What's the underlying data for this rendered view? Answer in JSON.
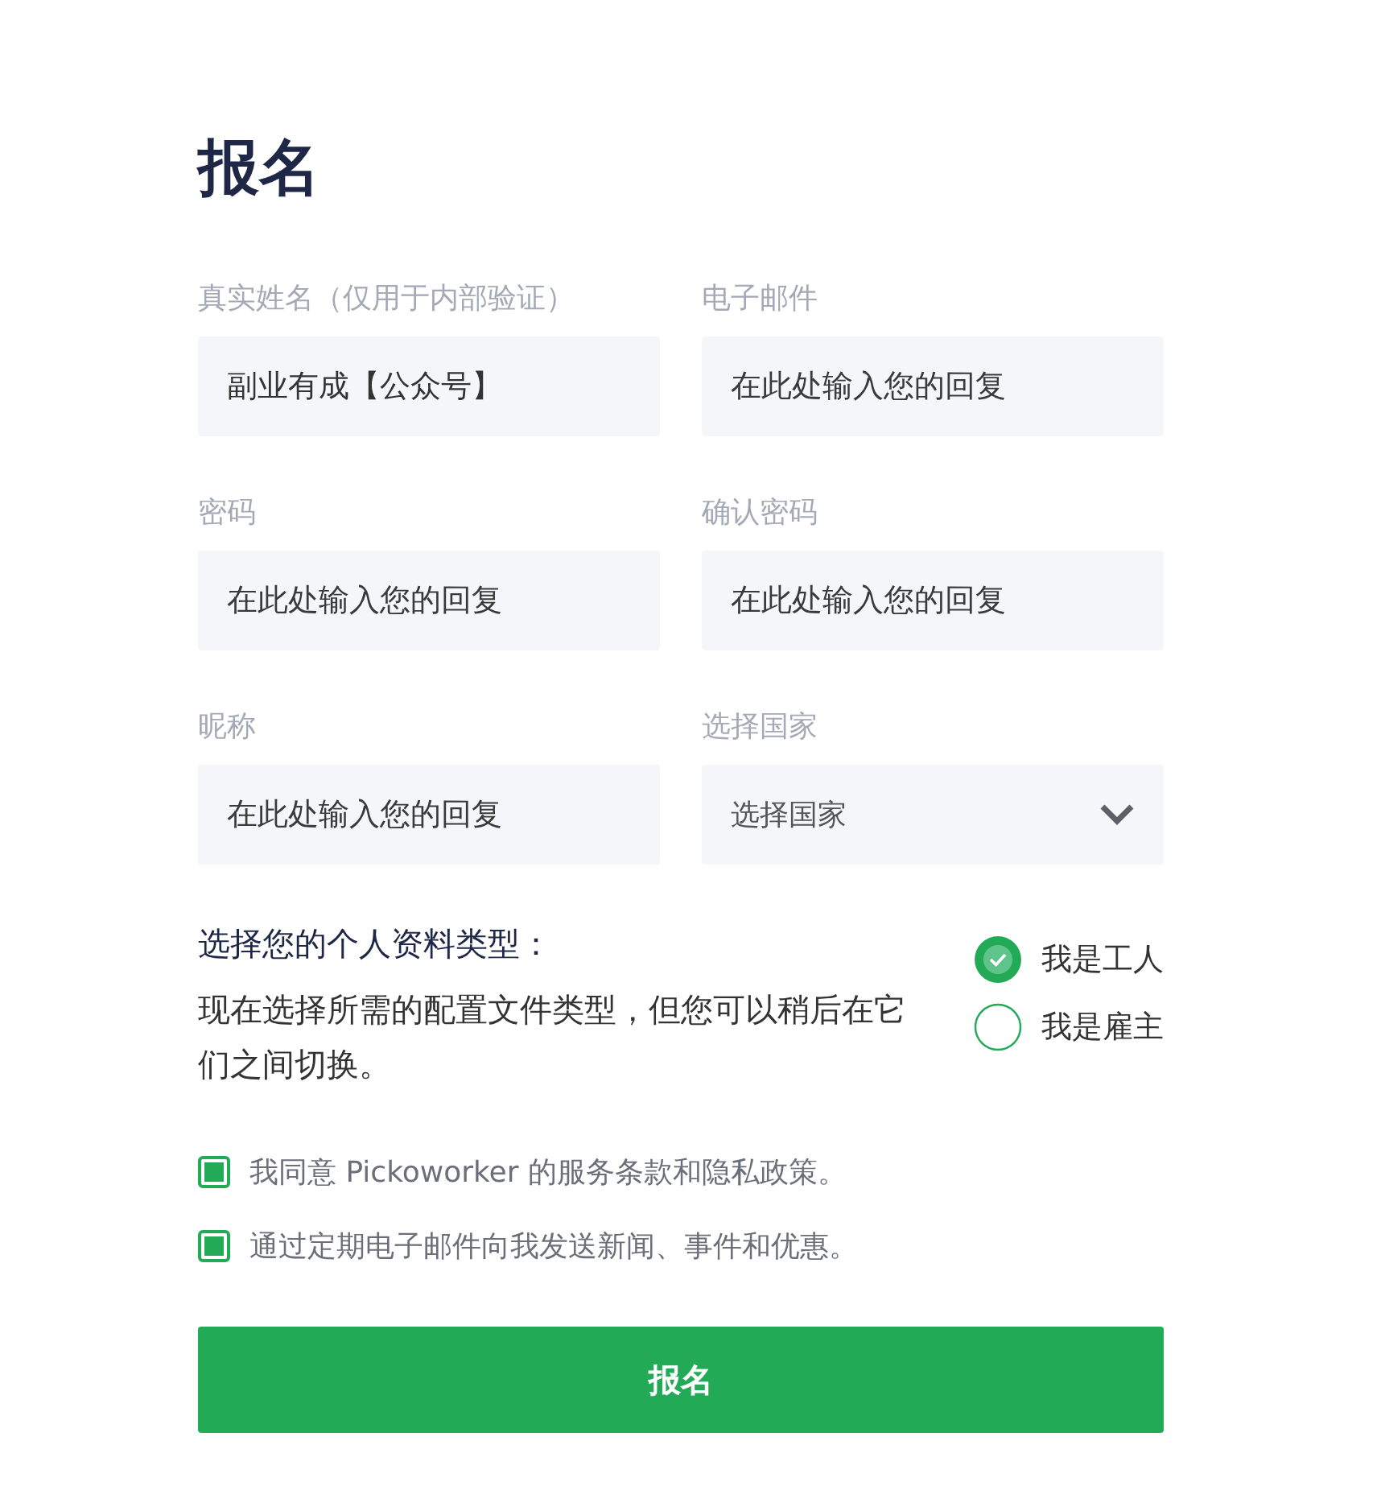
{
  "title": "报名",
  "fields": [
    {
      "kind": "text",
      "label": "真实姓名（仅用于内部验证）",
      "value": "副业有成【公众号】"
    },
    {
      "kind": "text",
      "label": "电子邮件",
      "placeholder": "在此处输入您的回复"
    },
    {
      "kind": "text",
      "label": "密码",
      "placeholder": "在此处输入您的回复"
    },
    {
      "kind": "text",
      "label": "确认密码",
      "placeholder": "在此处输入您的回复"
    },
    {
      "kind": "text",
      "label": "昵称",
      "placeholder": "在此处输入您的回复"
    },
    {
      "kind": "select",
      "label": "选择国家",
      "value": "选择国家"
    }
  ],
  "profile": {
    "heading": "选择您的个人资料类型：",
    "description": "现在选择所需的配置文件类型，但您可以稍后在它们之间切换。",
    "options": [
      {
        "label": "我是工人",
        "selected": true
      },
      {
        "label": "我是雇主",
        "selected": false
      }
    ]
  },
  "agreements": [
    {
      "label": "我同意 Pickoworker 的服务条款和隐私政策。",
      "checked": true
    },
    {
      "label": "通过定期电子邮件向我发送新闻、事件和优惠。",
      "checked": true
    }
  ],
  "submit": "报名"
}
